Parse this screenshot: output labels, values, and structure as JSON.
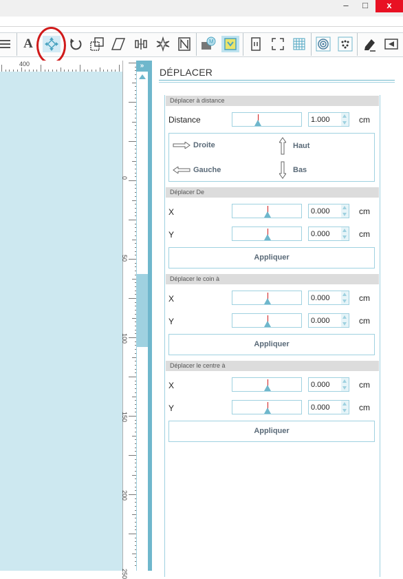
{
  "window": {
    "minimize_glyph": "–",
    "maximize_glyph": "□",
    "close_glyph": "x"
  },
  "toolbar": {
    "text_tool_glyph": "A",
    "icons": [
      "menu-lines-icon",
      "text-tool-icon",
      "move-tool-icon",
      "rotate-icon",
      "scale-icon",
      "shear-icon",
      "align-icon",
      "replicate-icon",
      "nesting-icon",
      "library-icon",
      "trace-icon",
      "page-setup-icon",
      "registration-marks-icon",
      "grid-icon",
      "offset-icon",
      "pixscan-icon",
      "sketch-icon",
      "send-icon"
    ],
    "active_tool": "move-tool-icon"
  },
  "ruler": {
    "top_label": "400",
    "left_labels": [
      "0",
      "50",
      "100",
      "150",
      "200",
      "250"
    ]
  },
  "panel": {
    "collapse_glyph": "»",
    "title": "DÉPLACER",
    "distance": {
      "section": "Déplacer à distance",
      "label": "Distance",
      "value": "1.000",
      "unit": "cm",
      "nudges": {
        "right": "Droite",
        "up": "Haut",
        "left": "Gauche",
        "down": "Bas"
      }
    },
    "move_from": {
      "section": "Déplacer De",
      "x_label": "X",
      "x_value": "0.000",
      "y_label": "Y",
      "y_value": "0.000",
      "unit": "cm",
      "apply": "Appliquer"
    },
    "move_corner": {
      "section": "Déplacer le coin à",
      "x_label": "X",
      "x_value": "0.000",
      "y_label": "Y",
      "y_value": "0.000",
      "unit": "cm",
      "apply": "Appliquer"
    },
    "move_center": {
      "section": "Déplacer le centre à",
      "x_label": "X",
      "x_value": "0.000",
      "y_label": "Y",
      "y_value": "0.000",
      "unit": "cm",
      "apply": "Appliquer"
    }
  },
  "colors": {
    "accent": "#6fb7cc",
    "canvas": "#cde8f0",
    "highlight_ring": "#d01a1a",
    "close_button": "#e81123"
  }
}
